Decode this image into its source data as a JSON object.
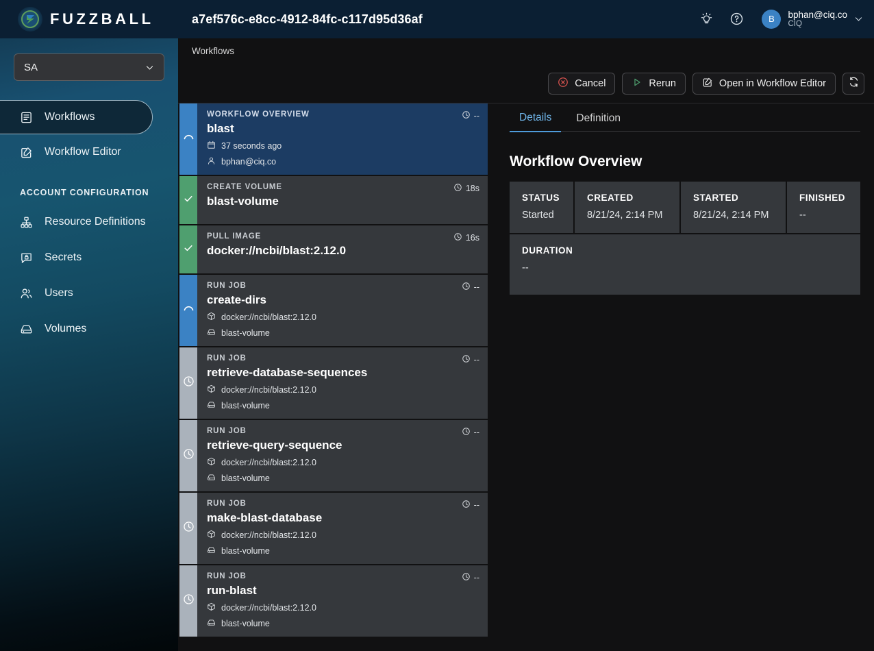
{
  "brand": {
    "name": "FUZZBALL",
    "logo_icon": "fuzzball-logo-icon"
  },
  "sidebar": {
    "tenant_selector": {
      "value": "SA",
      "icon": "chevron-down-icon"
    },
    "items": [
      {
        "label": "Workflows",
        "icon": "workflows-icon",
        "active": true
      },
      {
        "label": "Workflow Editor",
        "icon": "edit-square-icon",
        "active": false
      }
    ],
    "section_label": "ACCOUNT CONFIGURATION",
    "config_items": [
      {
        "label": "Resource Definitions",
        "icon": "sitemap-icon"
      },
      {
        "label": "Secrets",
        "icon": "secret-badge-icon"
      },
      {
        "label": "Users",
        "icon": "users-icon"
      },
      {
        "label": "Volumes",
        "icon": "drive-icon"
      }
    ]
  },
  "header": {
    "workflow_id": "a7ef576c-e8cc-4912-84fc-c117d95d36af",
    "theme_toggle_icon": "lightbulb-icon",
    "help_icon": "help-circle-icon",
    "user": {
      "avatar_initial": "B",
      "email": "bphan@ciq.co",
      "org": "CIQ",
      "menu_icon": "chevron-down-icon"
    }
  },
  "breadcrumb": {
    "items": [
      "Workflows"
    ]
  },
  "toolbar": {
    "cancel_label": "Cancel",
    "cancel_icon": "cancel-circle-icon",
    "rerun_label": "Rerun",
    "rerun_icon": "play-triangle-icon",
    "open_editor_label": "Open in Workflow Editor",
    "open_editor_icon": "edit-square-icon",
    "refresh_icon": "refresh-icon"
  },
  "cards": [
    {
      "kind": "WORKFLOW OVERVIEW",
      "title": "blast",
      "duration": "--",
      "state": "running",
      "selected": true,
      "meta": [
        {
          "icon": "calendar-icon",
          "text": "37 seconds ago"
        },
        {
          "icon": "user-icon",
          "text": "bphan@ciq.co"
        }
      ]
    },
    {
      "kind": "CREATE VOLUME",
      "title": "blast-volume",
      "duration": "18s",
      "state": "complete",
      "selected": false,
      "meta": []
    },
    {
      "kind": "PULL IMAGE",
      "title": "docker://ncbi/blast:2.12.0",
      "duration": "16s",
      "state": "complete",
      "selected": false,
      "meta": []
    },
    {
      "kind": "RUN JOB",
      "title": "create-dirs",
      "duration": "--",
      "state": "running",
      "selected": false,
      "meta": [
        {
          "icon": "container-icon",
          "text": "docker://ncbi/blast:2.12.0"
        },
        {
          "icon": "drive-icon",
          "text": "blast-volume"
        }
      ]
    },
    {
      "kind": "RUN JOB",
      "title": "retrieve-database-sequences",
      "duration": "--",
      "state": "pending",
      "selected": false,
      "meta": [
        {
          "icon": "container-icon",
          "text": "docker://ncbi/blast:2.12.0"
        },
        {
          "icon": "drive-icon",
          "text": "blast-volume"
        }
      ]
    },
    {
      "kind": "RUN JOB",
      "title": "retrieve-query-sequence",
      "duration": "--",
      "state": "pending",
      "selected": false,
      "meta": [
        {
          "icon": "container-icon",
          "text": "docker://ncbi/blast:2.12.0"
        },
        {
          "icon": "drive-icon",
          "text": "blast-volume"
        }
      ]
    },
    {
      "kind": "RUN JOB",
      "title": "make-blast-database",
      "duration": "--",
      "state": "pending",
      "selected": false,
      "meta": [
        {
          "icon": "container-icon",
          "text": "docker://ncbi/blast:2.12.0"
        },
        {
          "icon": "drive-icon",
          "text": "blast-volume"
        }
      ]
    },
    {
      "kind": "RUN JOB",
      "title": "run-blast",
      "duration": "--",
      "state": "pending",
      "selected": false,
      "meta": [
        {
          "icon": "container-icon",
          "text": "docker://ncbi/blast:2.12.0"
        },
        {
          "icon": "drive-icon",
          "text": "blast-volume"
        }
      ]
    }
  ],
  "detail": {
    "tabs": [
      {
        "label": "Details",
        "active": true
      },
      {
        "label": "Definition",
        "active": false
      }
    ],
    "title": "Workflow Overview",
    "fields": [
      {
        "key": "STATUS",
        "value": "Started"
      },
      {
        "key": "CREATED",
        "value": "8/21/24, 2:14 PM"
      },
      {
        "key": "STARTED",
        "value": "8/21/24, 2:14 PM"
      },
      {
        "key": "FINISHED",
        "value": "--"
      }
    ],
    "duration_field": {
      "key": "DURATION",
      "value": "--"
    }
  },
  "colors": {
    "accent_blue": "#3b82c4",
    "success_green": "#4f9f6f",
    "pending_gray": "#aab2bb",
    "danger_red": "#d9534f",
    "tab_active": "#6fb4e8",
    "sidebar_top": "#17556f",
    "header_navy": "#0b1f33"
  }
}
